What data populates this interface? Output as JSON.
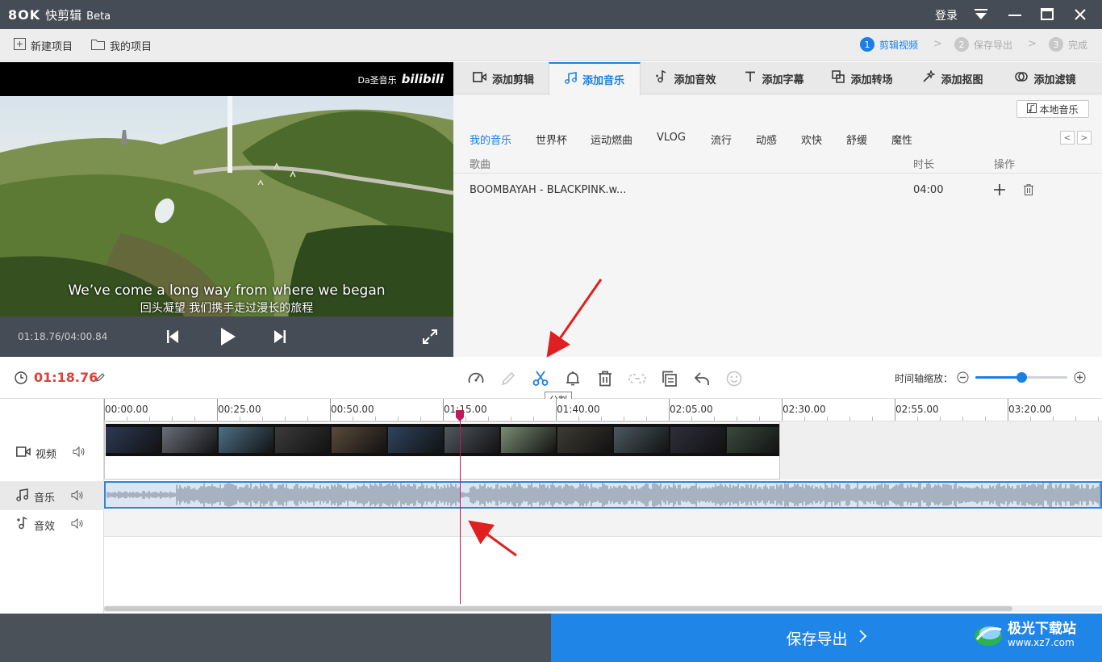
{
  "app": {
    "logo": "8OK",
    "name": "快剪辑",
    "edition": "Beta",
    "login": "登录"
  },
  "toolbar": {
    "new_project": "新建项目",
    "my_projects": "我的项目"
  },
  "steps": [
    {
      "num": "1",
      "label": "剪辑视频",
      "active": true
    },
    {
      "num": "2",
      "label": "保存导出",
      "active": false
    },
    {
      "num": "3",
      "label": "完成",
      "active": false
    }
  ],
  "player": {
    "watermark_prefix": "Da圣音乐",
    "watermark_brand": "bilibili",
    "subtitle_en": "We’ve come a long way from where we began",
    "subtitle_cn": "回头凝望 我们携手走过漫长的旅程",
    "time": "01:18.76/04:00.84"
  },
  "tabs": [
    {
      "label": "添加剪辑",
      "icon": "video-camera-icon"
    },
    {
      "label": "添加音乐",
      "icon": "music-note-icon",
      "active": true
    },
    {
      "label": "添加音效",
      "icon": "sound-effect-icon"
    },
    {
      "label": "添加字幕",
      "icon": "text-t-icon"
    },
    {
      "label": "添加转场",
      "icon": "transition-icon"
    },
    {
      "label": "添加抠图",
      "icon": "magic-wand-icon"
    },
    {
      "label": "添加滤镜",
      "icon": "filter-icon"
    }
  ],
  "music": {
    "local_button": "本地音乐",
    "categories": [
      "我的音乐",
      "世界杯",
      "运动燃曲",
      "VLOG",
      "流行",
      "动感",
      "欢快",
      "舒缓",
      "魔性"
    ],
    "columns": {
      "song": "歌曲",
      "duration": "时长",
      "action": "操作"
    },
    "songs": [
      {
        "name": "BOOMBAYAH - BLACKPINK.w...",
        "duration": "04:00"
      }
    ]
  },
  "edit": {
    "current_time": "01:18.76",
    "zoom_label": "时间轴缩放：",
    "zoom_level": 0.5,
    "tooltip": "分割"
  },
  "timeline": {
    "ticks": [
      "00:00.00",
      "00:25.00",
      "00:50.00",
      "01:15.00",
      "01:40.00",
      "02:05.00",
      "02:30.00",
      "02:55.00",
      "03:20.00"
    ],
    "tracks": {
      "video": "视频",
      "music": "音乐",
      "sfx": "音效"
    }
  },
  "footer": {
    "export": "保存导出"
  },
  "watermark": {
    "name": "极光下载站",
    "url": "www.xz7.com"
  },
  "colors": {
    "accent": "#1a7fe6",
    "time_red": "#d9433b",
    "playhead": "#c2185b",
    "annotation_arrow": "#e02020"
  }
}
